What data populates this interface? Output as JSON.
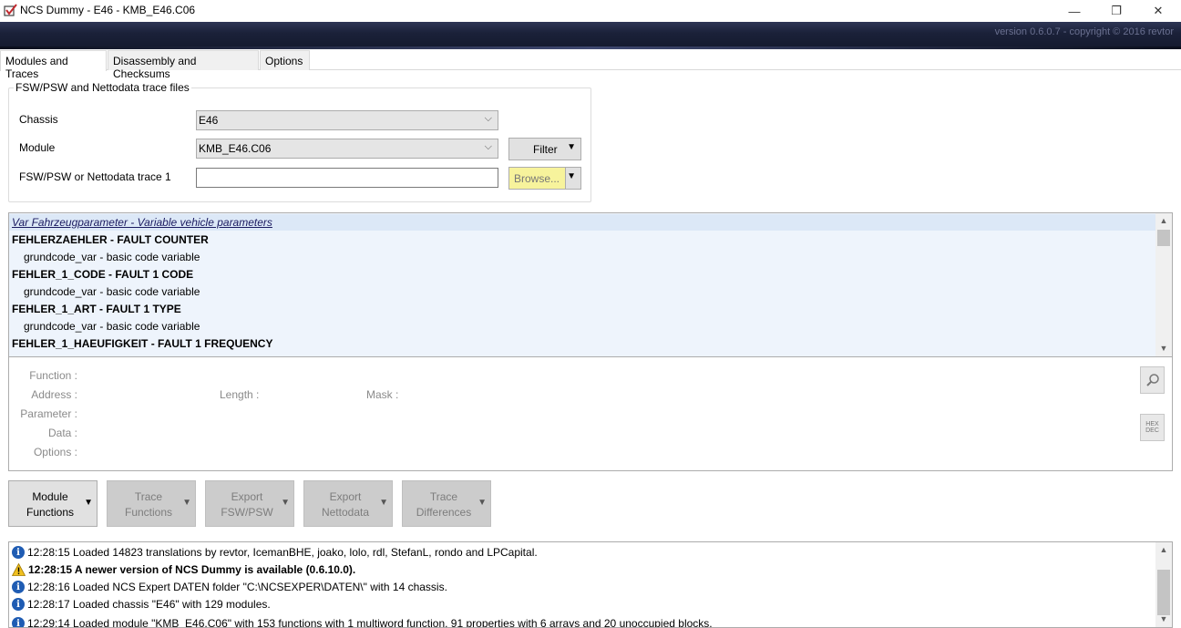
{
  "window": {
    "title": "NCS Dummy - E46 - KMB_E46.C06",
    "minimize_glyph": "—",
    "maximize_glyph": "❐",
    "close_glyph": "✕",
    "icon": "app-checkbox-icon"
  },
  "banner": {
    "version_text": "version 0.6.0.7 - copyright © 2016 revtor"
  },
  "tabs": [
    {
      "label": "Modules and Traces",
      "active": true
    },
    {
      "label": "Disassembly and Checksums",
      "active": false
    },
    {
      "label": "Options",
      "active": false
    }
  ],
  "trace_files": {
    "legend": "FSW/PSW and Nettodata trace files",
    "chassis_label": "Chassis",
    "chassis_value": "E46",
    "module_label": "Module",
    "module_value": "KMB_E46.C06",
    "trace_label": "FSW/PSW or Nettodata trace 1",
    "trace_value": "",
    "filter_label": "Filter",
    "browse_label": "Browse..."
  },
  "functions_list": {
    "items": [
      {
        "text": "Var Fahrzeugparameter  -  Variable vehicle parameters",
        "kind": "header"
      },
      {
        "text": "FEHLERZAEHLER  -  FAULT COUNTER",
        "kind": "bold"
      },
      {
        "text": "grundcode_var  -  basic code variable",
        "kind": "child"
      },
      {
        "text": "FEHLER_1_CODE  -  FAULT 1 CODE",
        "kind": "bold"
      },
      {
        "text": "grundcode_var  -  basic code variable",
        "kind": "child"
      },
      {
        "text": "FEHLER_1_ART  -  FAULT 1 TYPE",
        "kind": "bold"
      },
      {
        "text": "grundcode_var  -  basic code variable",
        "kind": "child"
      },
      {
        "text": "FEHLER_1_HAEUFIGKEIT  -  FAULT 1 FREQUENCY",
        "kind": "bold"
      }
    ]
  },
  "details": {
    "function_label": "Function :",
    "address_label": "Address :",
    "length_label": "Length :",
    "mask_label": "Mask :",
    "parameter_label": "Parameter :",
    "data_label": "Data :",
    "options_label": "Options :",
    "hexdec_line1": "HEX",
    "hexdec_line2": "DEC"
  },
  "action_buttons": [
    {
      "line1": "Module",
      "line2": "Functions",
      "enabled": true
    },
    {
      "line1": "Trace",
      "line2": "Functions",
      "enabled": false
    },
    {
      "line1": "Export",
      "line2": "FSW/PSW",
      "enabled": false
    },
    {
      "line1": "Export",
      "line2": "Nettodata",
      "enabled": false
    },
    {
      "line1": "Trace",
      "line2": "Differences",
      "enabled": false
    }
  ],
  "log": [
    {
      "icon": "info",
      "text": "12:28:15  Loaded 14823 translations by revtor, IcemanBHE, joako, lolo, rdl, StefanL, rondo and LPCapital.",
      "bold": false
    },
    {
      "icon": "warning",
      "text": "12:28:15  A newer version of NCS Dummy is available (0.6.10.0).",
      "bold": true
    },
    {
      "icon": "info",
      "text": "12:28:16  Loaded NCS Expert DATEN folder \"C:\\NCSEXPER\\DATEN\\\" with 14 chassis.",
      "bold": false
    },
    {
      "icon": "info",
      "text": "12:28:17  Loaded chassis \"E46\" with 129 modules.",
      "bold": false
    },
    {
      "icon": "info",
      "text": "12:29:14  Loaded module \"KMB_E46.C06\" with 153 functions with 1 multiword function, 91 properties with 6 arrays and 20 unoccupied blocks.",
      "bold": false
    }
  ],
  "colors": {
    "banner": "#1b2139",
    "list_bg": "#eef4fc",
    "highlight": "#f7f39c",
    "info_icon": "#1f5cb3",
    "warning_icon": "#f0c020"
  }
}
